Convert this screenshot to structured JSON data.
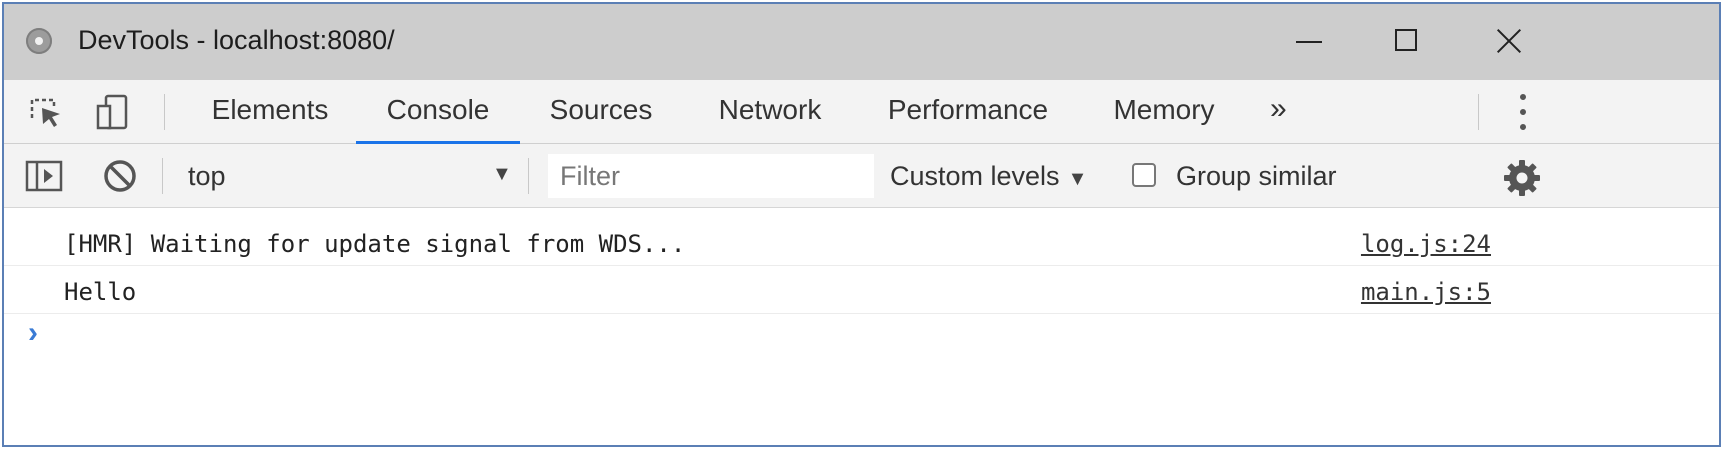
{
  "window": {
    "title": "DevTools - localhost:8080/",
    "frame_color": "#5b7fb5"
  },
  "tabs": [
    {
      "label": "Elements",
      "active": false
    },
    {
      "label": "Console",
      "active": true
    },
    {
      "label": "Sources",
      "active": false
    },
    {
      "label": "Network",
      "active": false
    },
    {
      "label": "Performance",
      "active": false
    },
    {
      "label": "Memory",
      "active": false
    }
  ],
  "tab_overflow_label": "»",
  "toolbar": {
    "context": "top",
    "filter_placeholder": "Filter",
    "levels_label": "Custom levels",
    "group_similar_label": "Group similar",
    "group_similar_checked": false
  },
  "console": {
    "messages": [
      {
        "text": "[HMR] Waiting for update signal from WDS...",
        "source": "log.js:24"
      },
      {
        "text": "Hello",
        "source": "main.js:5"
      }
    ],
    "prompt": "›"
  },
  "colors": {
    "active_tab_indicator": "#1a73e8",
    "prompt": "#3a7bd5"
  },
  "icons": [
    "app-icon",
    "minimize-icon",
    "maximize-icon",
    "close-icon",
    "inspect-element-icon",
    "device-toolbar-icon",
    "more-options-icon",
    "sidebar-toggle-icon",
    "clear-console-icon",
    "dropdown-arrow-icon",
    "settings-gear-icon"
  ]
}
